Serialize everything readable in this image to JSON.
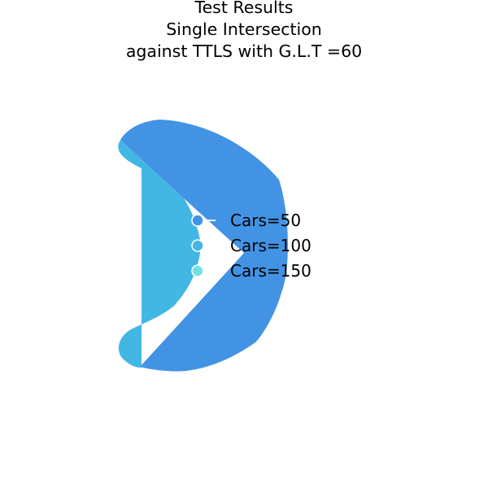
{
  "chart_data": {
    "type": "radial-area",
    "title_lines": [
      "Test Results",
      "Single Intersection",
      "against TTLS with G.L.T =60"
    ],
    "series": [
      {
        "name": "Cars=50",
        "color": "#4393e4"
      },
      {
        "name": "Cars=100",
        "color": "#43b7e4"
      },
      {
        "name": "Cars=150",
        "color": "#73e1e1"
      }
    ],
    "grid": false,
    "axes_visible": false,
    "legend_position": "center"
  }
}
